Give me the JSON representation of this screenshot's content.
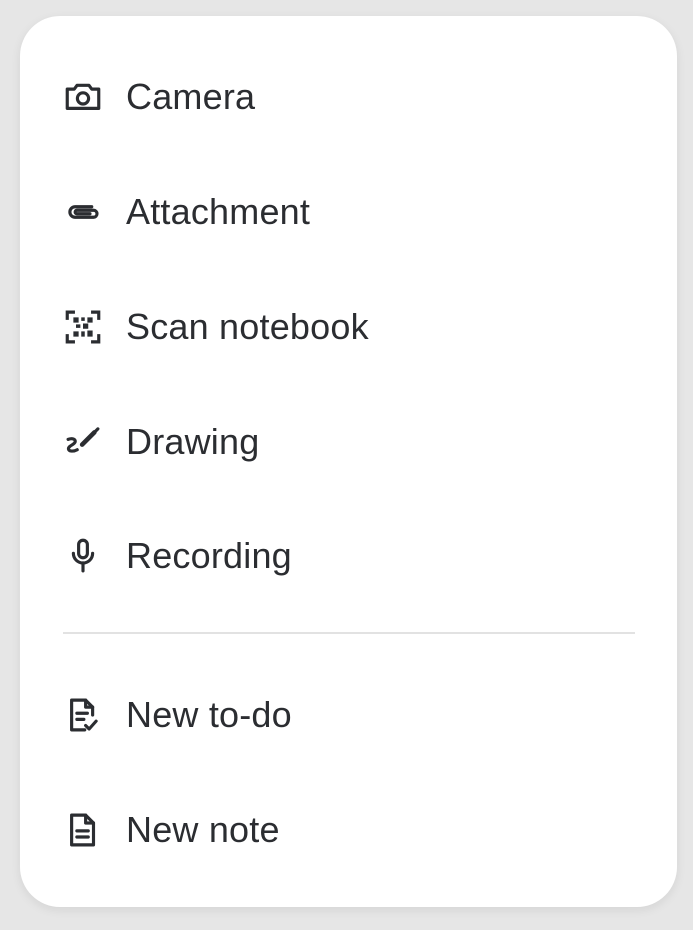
{
  "menu": {
    "items": [
      {
        "label": "Camera",
        "icon": "camera-icon"
      },
      {
        "label": "Attachment",
        "icon": "paperclip-icon"
      },
      {
        "label": "Scan notebook",
        "icon": "scan-icon"
      },
      {
        "label": "Drawing",
        "icon": "brush-icon"
      },
      {
        "label": "Recording",
        "icon": "microphone-icon"
      }
    ],
    "create_items": [
      {
        "label": "New to-do",
        "icon": "todo-document-icon"
      },
      {
        "label": "New note",
        "icon": "note-document-icon"
      }
    ]
  },
  "colors": {
    "background": "#e6e6e6",
    "card": "#ffffff",
    "text": "#2b2d31",
    "divider": "#e2e2e2"
  }
}
